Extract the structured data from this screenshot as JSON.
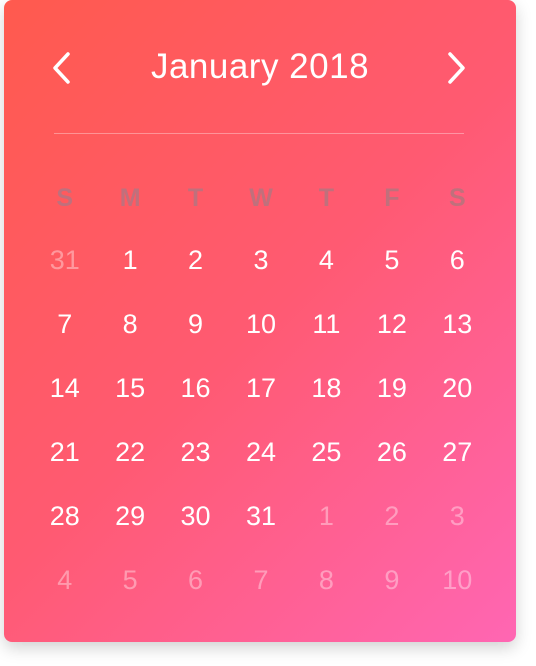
{
  "calendar": {
    "title": "January 2018",
    "prev_icon": "chevron-left-icon",
    "next_icon": "chevron-right-icon",
    "weekdays": [
      "S",
      "M",
      "T",
      "W",
      "T",
      "F",
      "S"
    ],
    "weeks": [
      [
        {
          "day": "31",
          "muted": true
        },
        {
          "day": "1",
          "muted": false
        },
        {
          "day": "2",
          "muted": false
        },
        {
          "day": "3",
          "muted": false
        },
        {
          "day": "4",
          "muted": false
        },
        {
          "day": "5",
          "muted": false
        },
        {
          "day": "6",
          "muted": false
        }
      ],
      [
        {
          "day": "7",
          "muted": false
        },
        {
          "day": "8",
          "muted": false
        },
        {
          "day": "9",
          "muted": false
        },
        {
          "day": "10",
          "muted": false
        },
        {
          "day": "11",
          "muted": false
        },
        {
          "day": "12",
          "muted": false
        },
        {
          "day": "13",
          "muted": false
        }
      ],
      [
        {
          "day": "14",
          "muted": false
        },
        {
          "day": "15",
          "muted": false
        },
        {
          "day": "16",
          "muted": false
        },
        {
          "day": "17",
          "muted": false
        },
        {
          "day": "18",
          "muted": false
        },
        {
          "day": "19",
          "muted": false
        },
        {
          "day": "20",
          "muted": false
        }
      ],
      [
        {
          "day": "21",
          "muted": false
        },
        {
          "day": "22",
          "muted": false
        },
        {
          "day": "23",
          "muted": false
        },
        {
          "day": "24",
          "muted": false
        },
        {
          "day": "25",
          "muted": false
        },
        {
          "day": "26",
          "muted": false
        },
        {
          "day": "27",
          "muted": false
        }
      ],
      [
        {
          "day": "28",
          "muted": false
        },
        {
          "day": "29",
          "muted": false
        },
        {
          "day": "30",
          "muted": false
        },
        {
          "day": "31",
          "muted": false
        },
        {
          "day": "1",
          "muted": true
        },
        {
          "day": "2",
          "muted": true
        },
        {
          "day": "3",
          "muted": true
        }
      ],
      [
        {
          "day": "4",
          "muted": true
        },
        {
          "day": "5",
          "muted": true
        },
        {
          "day": "6",
          "muted": true
        },
        {
          "day": "7",
          "muted": true
        },
        {
          "day": "8",
          "muted": true
        },
        {
          "day": "9",
          "muted": true
        },
        {
          "day": "10",
          "muted": true
        }
      ]
    ]
  },
  "colors": {
    "gradient_start": "#ff5a4e",
    "gradient_mid": "#ff5a72",
    "gradient_end": "#ff66b3",
    "text": "#ffffff",
    "weekday_text": "#c0707c"
  }
}
